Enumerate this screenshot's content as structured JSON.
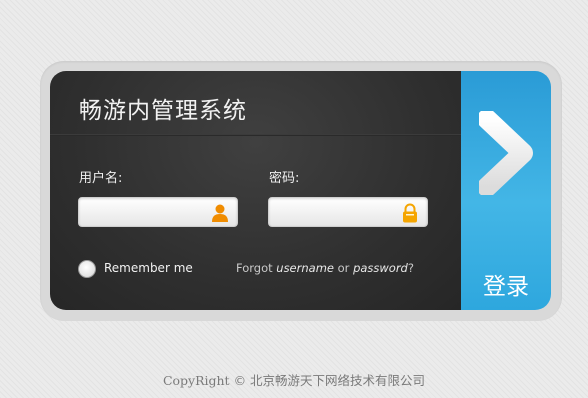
{
  "app": {
    "title": "畅游内管理系统"
  },
  "form": {
    "username_label": "用户名:",
    "username_value": "",
    "password_label": "密码:",
    "password_value": "",
    "remember_label": "Remember me",
    "remember_checked": false,
    "forgot": {
      "prefix": "Forgot",
      "username": "username",
      "or": "or",
      "password": "password",
      "suffix": "?"
    }
  },
  "login_button": {
    "label": "登录",
    "icon": "chevron-right-icon"
  },
  "footer": {
    "brand": "CopyRight",
    "symbol": "©",
    "company": "北京畅游天下网络技术有限公司"
  },
  "colors": {
    "accent": "#33aee2",
    "panel": "#333333",
    "user_icon": "#f08c00",
    "lock_icon": "#f5a500"
  }
}
